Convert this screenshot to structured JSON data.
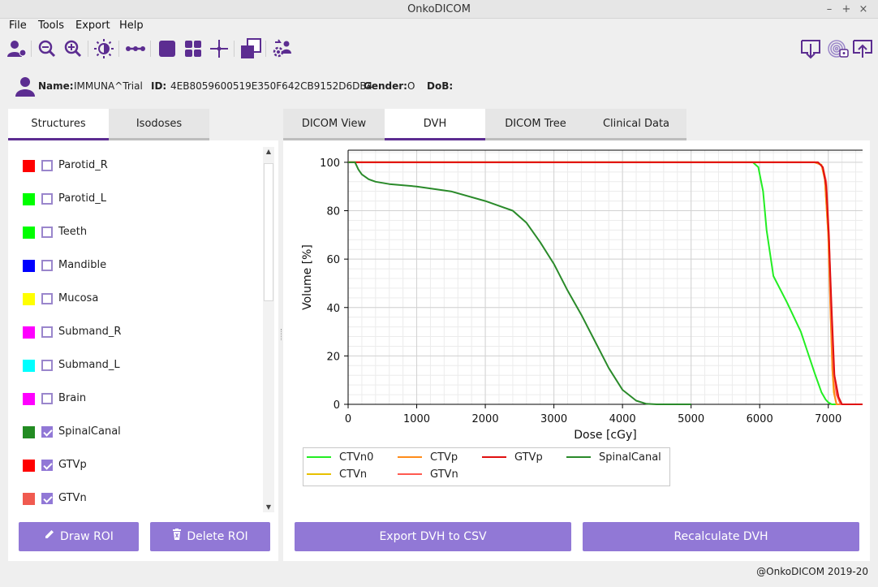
{
  "window": {
    "title": "OnkoDICOM",
    "controls": [
      "–",
      "+",
      "×"
    ]
  },
  "menu": [
    "File",
    "Tools",
    "Export",
    "Help"
  ],
  "toolbar": {
    "left_icons": [
      "patient-icon",
      "zoom-out-icon",
      "zoom-in-icon",
      "brightness-icon",
      "transect-icon",
      "single-view-icon",
      "four-view-icon",
      "crosshair-icon",
      "window-level-icon",
      "anonymize-icon"
    ],
    "right_icons": [
      "import-icon",
      "fingerprint-icon",
      "export-icon"
    ]
  },
  "patient": {
    "name_label": "Name:",
    "name": "IMMUNA^Trial",
    "id_label": "ID:",
    "id": "4EB8059600519E350F642CB9152D6DB4",
    "gender_label": "Gender:",
    "gender": "O",
    "dob_label": "DoB:",
    "dob": ""
  },
  "left_tabs": [
    {
      "label": "Structures",
      "active": true
    },
    {
      "label": "Isodoses",
      "active": false
    }
  ],
  "structures": [
    {
      "name": "Parotid_R",
      "color": "#ff0000",
      "checked": false
    },
    {
      "name": "Parotid_L",
      "color": "#00ff00",
      "checked": false
    },
    {
      "name": "Teeth",
      "color": "#00ff00",
      "checked": false
    },
    {
      "name": "Mandible",
      "color": "#0000ff",
      "checked": false
    },
    {
      "name": "Mucosa",
      "color": "#ffff00",
      "checked": false
    },
    {
      "name": "Submand_R",
      "color": "#ff00ff",
      "checked": false
    },
    {
      "name": "Submand_L",
      "color": "#00ffff",
      "checked": false
    },
    {
      "name": "Brain",
      "color": "#ff00ff",
      "checked": false
    },
    {
      "name": "SpinalCanal",
      "color": "#228b22",
      "checked": true
    },
    {
      "name": "GTVp",
      "color": "#ff0000",
      "checked": true
    },
    {
      "name": "GTVn",
      "color": "#f05a50",
      "checked": true
    }
  ],
  "left_buttons": {
    "draw": "Draw ROI",
    "delete": "Delete ROI"
  },
  "right_tabs": [
    {
      "label": "DICOM View",
      "active": false
    },
    {
      "label": "DVH",
      "active": true
    },
    {
      "label": "DICOM Tree",
      "active": false
    },
    {
      "label": "Clinical Data",
      "active": false
    }
  ],
  "right_buttons": {
    "export": "Export DVH to CSV",
    "recalc": "Recalculate DVH"
  },
  "footer": "@OnkoDICOM 2019-20",
  "colors": {
    "accent": "#9178d6",
    "accent_dark": "#5c2d91"
  },
  "chart_data": {
    "type": "line",
    "xlabel": "Dose [cGy]",
    "ylabel": "Volume [%]",
    "xlim": [
      0,
      7500
    ],
    "ylim": [
      0,
      105
    ],
    "xticks": [
      0,
      1000,
      2000,
      3000,
      4000,
      5000,
      6000,
      7000
    ],
    "yticks": [
      0,
      20,
      40,
      60,
      80,
      100
    ],
    "grid": true,
    "legend_position": "bottom",
    "series": [
      {
        "name": "CTVn0",
        "color": "#22ee22",
        "x": [
          0,
          5900,
          5980,
          6050,
          6100,
          6200,
          6400,
          6600,
          6800,
          6900,
          6960,
          7000,
          7050,
          7500
        ],
        "y": [
          100,
          100,
          98,
          88,
          72,
          53,
          42,
          30,
          13,
          5,
          2,
          0.8,
          0,
          0
        ]
      },
      {
        "name": "CTVn",
        "color": "#e8c000",
        "x": [
          0,
          6800,
          6900,
          6950,
          7000,
          7030,
          7060,
          7080,
          7120,
          7500
        ],
        "y": [
          100,
          100,
          99,
          93,
          70,
          42,
          15,
          5,
          0,
          0
        ]
      },
      {
        "name": "CTVp",
        "color": "#ff8c1a",
        "x": [
          0,
          6800,
          6900,
          6950,
          7000,
          7030,
          7060,
          7090,
          7120,
          7500
        ],
        "y": [
          100,
          100,
          99,
          93,
          70,
          40,
          14,
          4,
          0,
          0
        ]
      },
      {
        "name": "GTVn",
        "color": "#ff5a50",
        "x": [
          0,
          6850,
          6920,
          6970,
          7010,
          7040,
          7080,
          7120,
          7180,
          7500
        ],
        "y": [
          100,
          100,
          98,
          92,
          70,
          40,
          14,
          4,
          0,
          0
        ]
      },
      {
        "name": "GTVp",
        "color": "#e01010",
        "x": [
          0,
          6850,
          6920,
          6970,
          7010,
          7050,
          7090,
          7150,
          7200,
          7500
        ],
        "y": [
          100,
          100,
          98,
          90,
          68,
          38,
          12,
          3,
          0,
          0
        ]
      },
      {
        "name": "SpinalCanal",
        "color": "#2a8a2a",
        "x": [
          0,
          100,
          150,
          200,
          300,
          400,
          600,
          1000,
          1500,
          2000,
          2400,
          2600,
          2800,
          3000,
          3200,
          3400,
          3600,
          3800,
          4000,
          4200,
          4350,
          4500,
          5000
        ],
        "y": [
          100,
          100,
          97,
          95,
          93,
          92,
          91,
          90,
          88,
          84,
          80,
          75,
          67,
          58,
          47,
          37,
          26,
          15,
          6,
          1.5,
          0.2,
          0,
          0
        ]
      }
    ]
  }
}
